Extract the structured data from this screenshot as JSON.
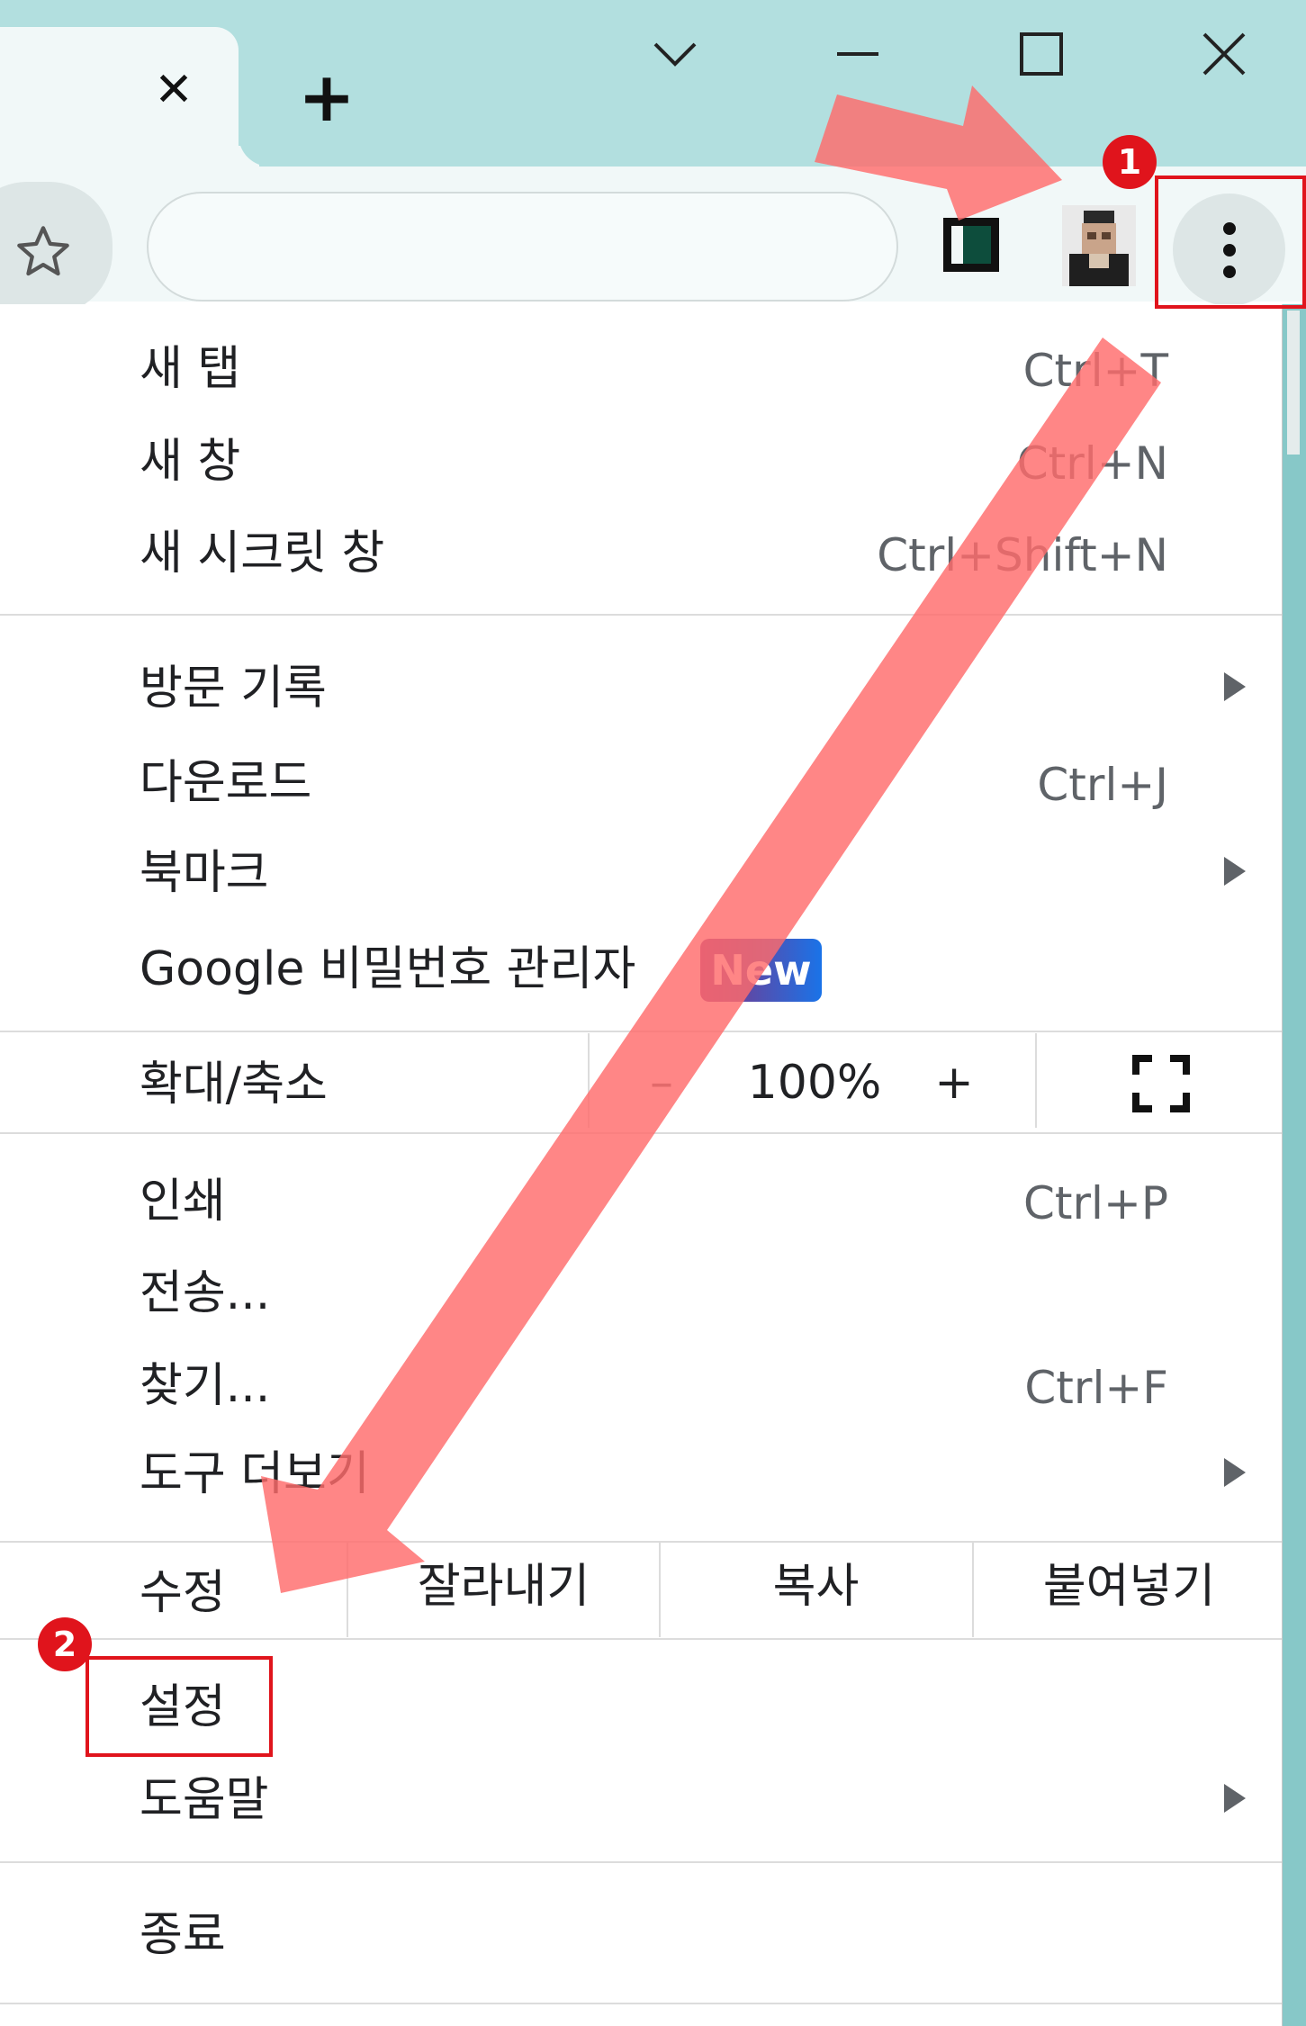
{
  "tabstrip": {
    "tab_close_glyph": "✕",
    "new_tab_glyph": "+",
    "window_controls": [
      "chevron-down-icon",
      "minimize-icon",
      "maximize-icon",
      "close-icon"
    ]
  },
  "toolbar": {
    "bookmark_icon": "star-icon",
    "side_panel_icon": "side-panel-icon",
    "profile_icon": "avatar",
    "menu_icon": "kebab-menu-icon"
  },
  "menu": {
    "group1": [
      {
        "label": "새 탭",
        "shortcut": "Ctrl+T"
      },
      {
        "label": "새 창",
        "shortcut": "Ctrl+N"
      },
      {
        "label": "새 시크릿 창",
        "shortcut": "Ctrl+Shift+N"
      }
    ],
    "group2": [
      {
        "label": "방문 기록",
        "shortcut": ""
      },
      {
        "label": "다운로드",
        "shortcut": "Ctrl+J"
      },
      {
        "label": "북마크",
        "shortcut": ""
      },
      {
        "label": "Google 비밀번호 관리자",
        "shortcut": "",
        "badge": "New"
      }
    ],
    "zoom": {
      "label": "확대/축소",
      "minus": "–",
      "value": "100%",
      "plus": "+",
      "fullscreen_icon": "fullscreen-icon"
    },
    "group3": [
      {
        "label": "인쇄",
        "shortcut": "Ctrl+P"
      },
      {
        "label": "전송...",
        "shortcut": ""
      },
      {
        "label": "찾기...",
        "shortcut": "Ctrl+F"
      },
      {
        "label": "도구 더보기",
        "shortcut": ""
      }
    ],
    "edit": {
      "label": "수정",
      "cut": "잘라내기",
      "copy": "복사",
      "paste": "붙여넣기"
    },
    "group4": [
      {
        "label": "설정"
      },
      {
        "label": "도움말"
      }
    ],
    "exit": {
      "label": "종료"
    }
  },
  "annotations": {
    "step1": "1",
    "step2": "2",
    "accent_color": "#e0141c",
    "arrow_color": "#ff6b6b"
  }
}
